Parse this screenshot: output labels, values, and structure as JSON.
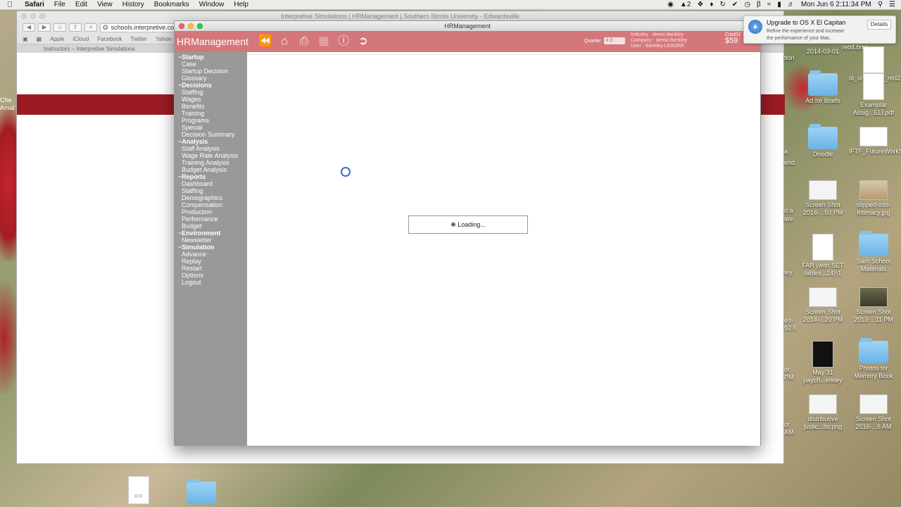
{
  "menubar": {
    "app": "Safari",
    "items": [
      "File",
      "Edit",
      "View",
      "History",
      "Bookmarks",
      "Window",
      "Help"
    ],
    "status_num": "2",
    "clock": "Mon Jun 6  2:11:34 PM"
  },
  "safari": {
    "title": "Interpretive Simulations | HRManagement | Southern Illinois University - Edwardsville",
    "url": "schools.interpretive.com",
    "favorites": [
      "Apple",
      "iCloud",
      "Facebook",
      "Twitter",
      "Yahoo"
    ],
    "tab": "Instructors – Interpretive Simulations",
    "left_edge_text": "Che\nAmal"
  },
  "hr": {
    "window_title": "HRManagement",
    "brand": "HRManagement",
    "quarter_label": "Quarter",
    "quarter_value": "# 0",
    "industry": "Industry : demo:rberkley",
    "company": "Company : demo:rberkley",
    "user": "User : rberkley-LEADER",
    "cost_label": "Cost/U",
    "cost_value": "$59",
    "loading": "Loading...",
    "sidebar": [
      {
        "group": "Startup",
        "items": [
          "Case",
          "Startup Decision",
          "Glossary"
        ]
      },
      {
        "group": "Decisions",
        "items": [
          "Staffing",
          "Wages",
          "Benefits",
          "Training",
          "Programs",
          "Special",
          "Decision Summary"
        ]
      },
      {
        "group": "Analysis",
        "items": [
          "Staff Analysis",
          "Wage Rate Analysis",
          "Training Analysis",
          "Budget Analysis"
        ]
      },
      {
        "group": "Reports",
        "items": [
          "Dashboard",
          "Staffing",
          "Demographics",
          "Compensation",
          "Production",
          "Performance",
          "Budget"
        ]
      },
      {
        "group": "Environment",
        "items": [
          "Newsletter"
        ]
      },
      {
        "group": "Simulation",
        "items": [
          "Advance",
          "Replay",
          "Restart",
          "Options",
          "Logout"
        ]
      }
    ]
  },
  "notification": {
    "title": "Upgrade to OS X El Capitan",
    "body": "Refine the experience and increase the performance of your Mac.",
    "button": "Details"
  },
  "desktop": {
    "top_partial": "red4.bmp",
    "icons": [
      {
        "label": "2014-03-01",
        "kind": "shot-hidden"
      },
      {
        "label": "di_university_red2.bmp",
        "kind": "doc"
      },
      {
        "label": "Ad for Briefs",
        "kind": "folder"
      },
      {
        "label": "Examplar Assig...ELI.pdf",
        "kind": "doc"
      },
      {
        "label": "Doodle",
        "kind": "folder"
      },
      {
        "label": "IFTF_FutureWorkSki...01.gif",
        "kind": "dots"
      },
      {
        "label": "Screen Shot 2014-...50 PM",
        "kind": "shot"
      },
      {
        "label": "slipped-into-intimacy.jpg",
        "kind": "card"
      },
      {
        "label": "FAR (with SET tables...14)-1",
        "kind": "doc"
      },
      {
        "label": "Sam School Materials",
        "kind": "folder"
      },
      {
        "label": "Screen Shot 2014-...20 PM",
        "kind": "shot"
      },
      {
        "label": "Screen Shot 2013-...11 PM",
        "kind": "dark"
      },
      {
        "label": "May 31 paych...erkley",
        "kind": "pdf"
      },
      {
        "label": "Photos for Memory Book",
        "kind": "folder"
      },
      {
        "label": "distributive justic...lts.png",
        "kind": "shot"
      },
      {
        "label": "Screen Shot 2016-...6 AM",
        "kind": "shot"
      }
    ],
    "partials": [
      "tion",
      "a",
      "end",
      "d a",
      "tee",
      "ley",
      "ed-",
      "92-5",
      "ot",
      "PM",
      "ot",
      "AM"
    ],
    "bottom": [
      "RTF"
    ]
  }
}
